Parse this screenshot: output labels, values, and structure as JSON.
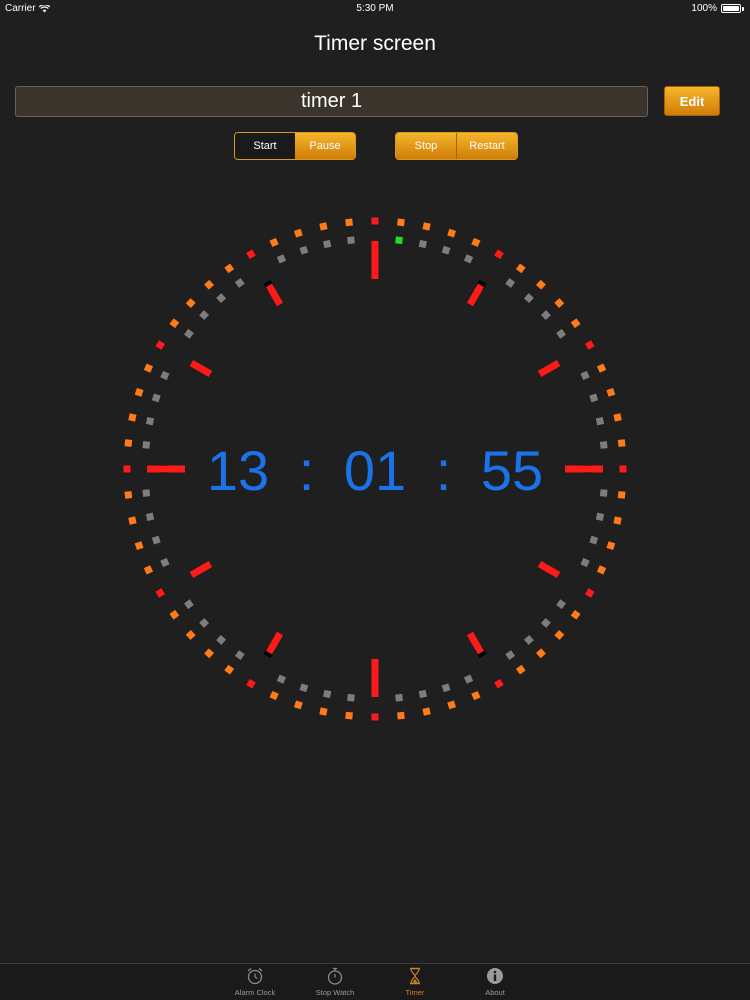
{
  "status_bar": {
    "carrier": "Carrier",
    "time": "5:30 PM",
    "battery": "100%"
  },
  "header": {
    "title": "Timer screen"
  },
  "timer_name": {
    "value": "timer 1",
    "placeholder": ""
  },
  "edit_button": {
    "label": "Edit"
  },
  "controls": {
    "start_label": "Start",
    "pause_label": "Pause",
    "stop_label": "Stop",
    "restart_label": "Restart"
  },
  "clock": {
    "time_display": {
      "h": "13",
      "m": "01",
      "s": "55",
      "sep": ":"
    },
    "colors": {
      "time_text": "#1a73e8",
      "major_tick": "#ff1a1a",
      "outer_dot": "#ff7a1a",
      "inner_dot": "#7d7d7d",
      "active_dot": "#22dd22",
      "marker_dot": "#000000"
    },
    "elapsed_seconds_on_ring": 1,
    "marker_dot_positions": [
      5,
      15,
      25,
      35,
      45,
      55
    ]
  },
  "tab_bar": {
    "tabs": [
      {
        "name": "alarm",
        "label": "Alarm Clock",
        "icon": "alarm-clock-icon",
        "active": false
      },
      {
        "name": "stopwatch",
        "label": "Stop Watch",
        "icon": "stopwatch-icon",
        "active": false
      },
      {
        "name": "timer",
        "label": "Timer",
        "icon": "hourglass-icon",
        "active": true
      },
      {
        "name": "about",
        "label": "About",
        "icon": "info-icon",
        "active": false
      }
    ]
  }
}
